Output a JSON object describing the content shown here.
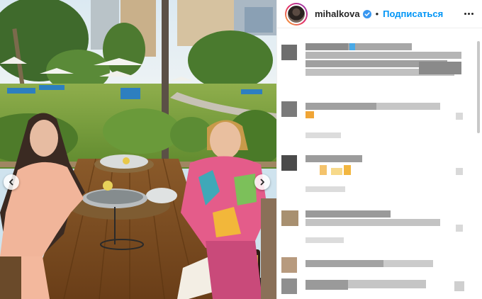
{
  "post": {
    "username": "mihalkova",
    "follow_label": "Подписаться",
    "separator": "•",
    "verified_icon": "verified-badge-icon",
    "more_icon": "more-options-icon",
    "prev_icon": "chevron-left-icon",
    "next_icon": "chevron-right-icon"
  },
  "colors": {
    "follow": "#0095f6",
    "verified": "#3897f0",
    "text": "#262626",
    "divider": "#efefef"
  },
  "comments": {
    "pixelated": true,
    "count_visible": 7
  }
}
